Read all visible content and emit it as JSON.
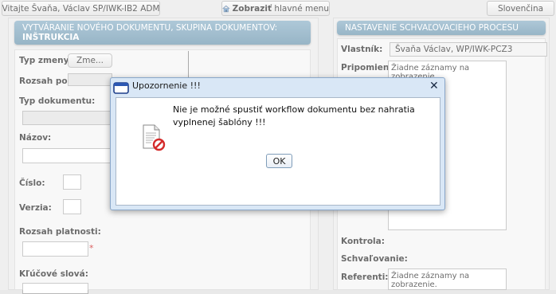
{
  "topbar": {
    "welcome": "Vitajte Švaňa, Václav SP/IWK-IB2 ADM",
    "show_menu_bold": "Zobraziť",
    "show_menu_rest": " hlavné menu",
    "language": "Slovenčina"
  },
  "left_panel": {
    "header_line1": "VYTVÁRANIE NOVÉHO DOKUMENTU, SKUPINA DOKUMENTOV:",
    "header_line2": "INŠTRUKCIA",
    "typ_zmeny_label": "Typ zmeny:",
    "typ_zmeny_button": "Zme...",
    "rozsah_label": "Rozsah použ",
    "typ_dokumentu_label": "Typ dokumentu:",
    "nazov_label": "Názov:",
    "cislo_label": "Číslo:",
    "verzia_label": "Verzia:",
    "rozsah_platnosti_label": "Rozsah platnosti:",
    "required_mark": "*",
    "klucove_slova_label": "Kľúčové slová:"
  },
  "right_panel": {
    "header": "NASTAVENIE SCHVAĽOVACIEHO PROCESU",
    "vlastnik_label": "Vlastník:",
    "vlastnik_value": "Švaňa Václav, WP/IWK-PCZ3",
    "pripomienkovanie_label": "Pripomienko",
    "no_records_1": "Žiadne záznamy na zobrazenie.",
    "kontrola_label": "Kontrola:",
    "schvalovanie_label": "Schvaľovanie:",
    "referenti_label": "Referenti:",
    "no_records_2": "Žiadne záznamy na zobrazenie."
  },
  "dialog": {
    "title": "Upozornenie !!!",
    "close": "✕",
    "message": "Nie je možné spustiť workflow dokumentu bez nahratia vyplnenej šablóny !!!",
    "ok": "OK"
  },
  "colors": {
    "panel_header": "#7fa6be",
    "dialog_border": "#8aa7c9",
    "required": "#cc2222"
  }
}
